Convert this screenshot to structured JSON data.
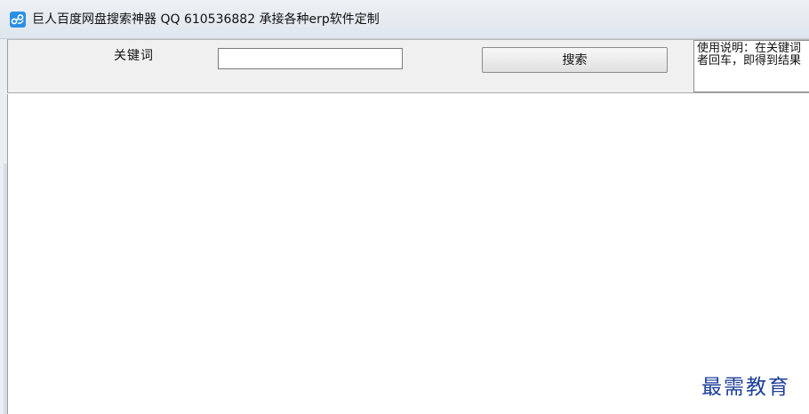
{
  "window": {
    "title": "巨人百度网盘搜索神器  QQ 610536882 承接各种erp软件定制",
    "icon": "cloud-share-icon"
  },
  "toolbar": {
    "keyword_label": "关键词",
    "keyword_value": "",
    "search_button_label": "搜索",
    "instructions_line1": "使用说明：在关键词",
    "instructions_line2": "者回车，即得到结果"
  },
  "watermark": {
    "text": "最需教育"
  },
  "colors": {
    "titlebar": "#dfe6ee",
    "toolbar": "#f0f0f0",
    "watermark": "#1d3f98",
    "app_icon": "#2b8fe5"
  }
}
